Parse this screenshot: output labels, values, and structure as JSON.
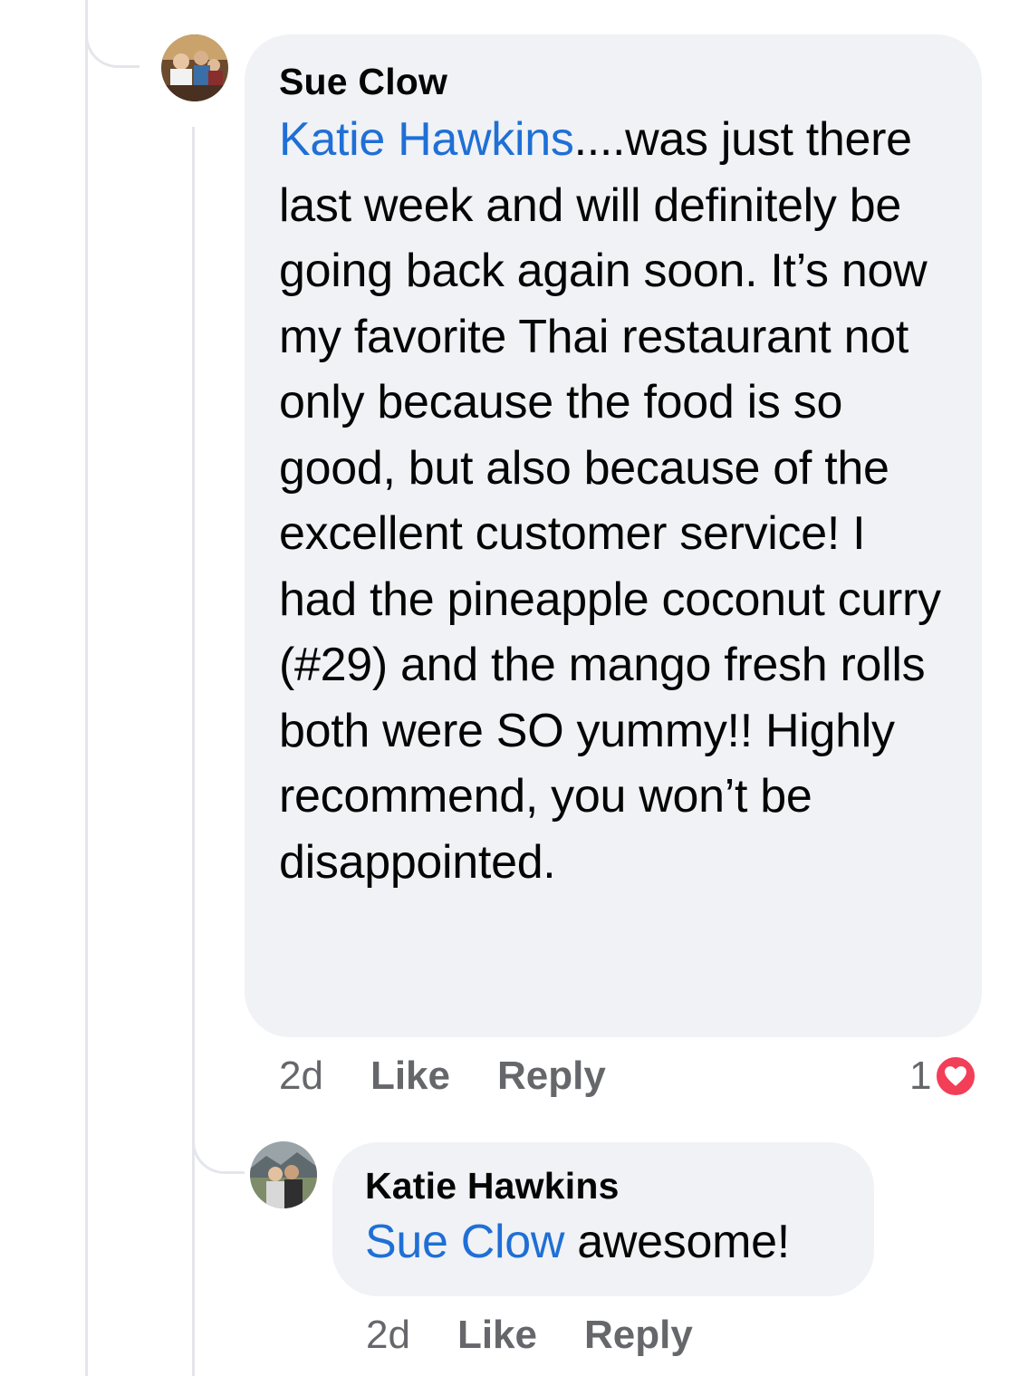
{
  "comments": [
    {
      "author": "Sue Clow",
      "mention": "Katie Hawkins",
      "text": "....was just there last week and will definitely be going back again soon. It’s now my favorite Thai restaurant not only because the food is so good, but also because of the excellent customer service! I had the pineapple coconut curry (#29) and the mango fresh rolls both were SO yummy!! Highly recommend, you won’t be disappointed.",
      "time": "2d",
      "like_label": "Like",
      "reply_label": "Reply",
      "reaction_count": "1",
      "reaction_icon": "heart-icon"
    },
    {
      "author": "Katie Hawkins",
      "mention": "Sue Clow",
      "text": " awesome!",
      "time": "2d",
      "like_label": "Like",
      "reply_label": "Reply"
    }
  ],
  "colors": {
    "mention": "#1f6fd6",
    "bubble": "#f0f2f5",
    "meta": "#65676b",
    "reaction": "#f33e58"
  }
}
